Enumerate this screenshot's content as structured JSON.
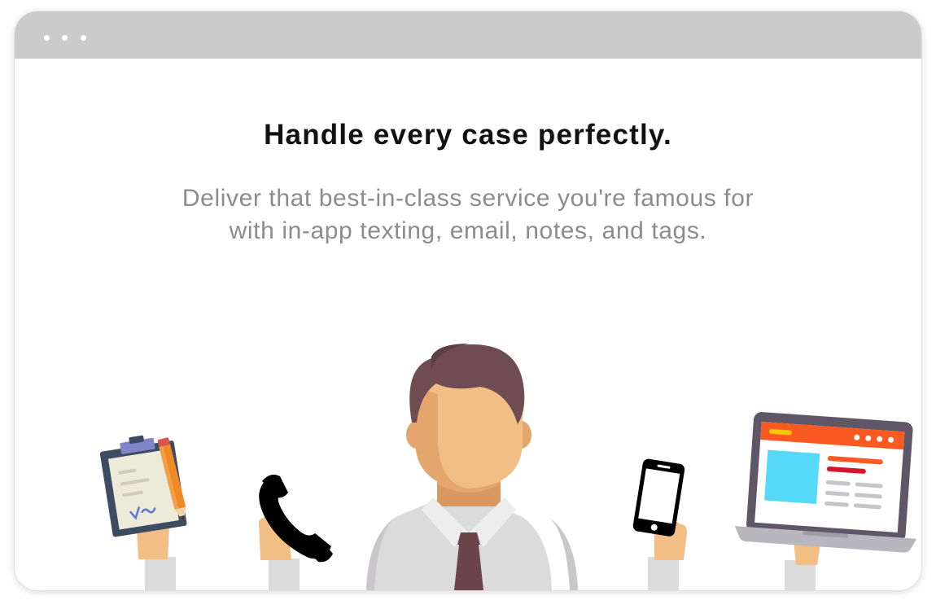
{
  "window": {
    "controls": [
      "dot-icon",
      "dot-icon",
      "dot-icon"
    ]
  },
  "hero": {
    "headline": "Handle every case perfectly.",
    "subtext_line1": "Deliver that best-in-class service you're famous for",
    "subtext_line2": "with in-app texting, email, notes, and tags."
  },
  "illustration": {
    "items": [
      "clipboard-icon",
      "pencil-icon",
      "phone-handset-icon",
      "person-avatar",
      "smartphone-icon",
      "laptop-icon"
    ],
    "colors": {
      "hair": "#6f4b52",
      "skin": "#f1bf85",
      "skin_shadow": "#e3a66d",
      "shirt": "#dcdbdc",
      "tie": "#6a4448",
      "laptop_body": "#5f5667",
      "laptop_bar": "#fa5a22",
      "laptop_image": "#56d9f8",
      "clipboard_frame": "#3d4b63",
      "clipboard_paper": "#ecead8",
      "pencil": "#f08a24"
    }
  }
}
